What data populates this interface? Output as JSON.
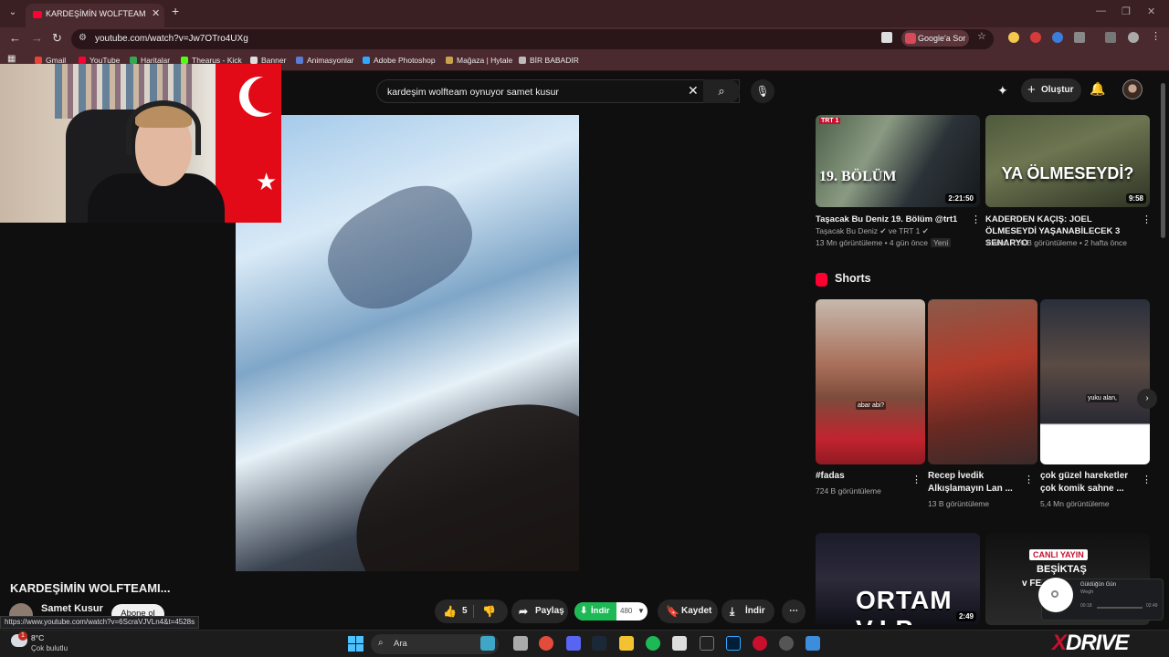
{
  "browser": {
    "tab_title": "KARDEŞİMİN WOLFTEAMI... - Yo",
    "url": "youtube.com/watch?v=Jw7OTro4UXg",
    "google_ask_label": "Google'a Sor",
    "bookmarks": [
      "Gmail",
      "YouTube",
      "Haritalar",
      "Thearus - Kick",
      "Banner",
      "Animasyonlar",
      "Adobe Photoshop",
      "Mağaza | Hytale",
      "BİR BABADIR"
    ]
  },
  "youtube": {
    "search_query": "kardeşim wolfteam oynuyor samet kusur",
    "create_label": "Oluştur",
    "video_title": "KARDEŞİMİN WOLFTEAMI...",
    "channel_name": "Samet Kusur",
    "subscribe_label": "Abone ol",
    "like_count": "5",
    "share_label": "Paylaş",
    "download_ext_label": "İndir",
    "download_ext_quality": "480",
    "save_label": "Kaydet",
    "download_label": "İndir",
    "status_link": "https://www.youtube.com/watch?v=6ScraVJVLn4&t=4528s"
  },
  "recommendations": [
    {
      "title": "Taşacak Bu Deniz 19. Bölüm @trt1",
      "channel": "Taşacak Bu Deniz ✔ ve TRT 1 ✔",
      "stats": "13 Mn görüntüleme • 4 gün önce",
      "badge": "Yeni",
      "duration": "2:21:50",
      "thumb_text": "19. BÖLÜM",
      "thumb_logo": "TRT 1"
    },
    {
      "title": "KADERDEN KAÇIŞ: JOEL ÖLMESEYDİ YAŞANABİLECEK 3 SENARYO",
      "stats": "Yokfire • 16 B görüntüleme • 2 hafta önce",
      "duration": "9:58",
      "thumb_text": "YA ÖLMESEYDİ?"
    }
  ],
  "shorts": {
    "heading": "Shorts",
    "items": [
      {
        "title": "#fadas",
        "views": "724 B görüntüleme",
        "caption": "abar abi?"
      },
      {
        "title": "Recep İvedik Alkışlamayın Lan ...",
        "views": "13 B görüntüleme",
        "caption": ""
      },
      {
        "title": "çok güzel hareketler çok komik sahne ...",
        "views": "5,4 Mn görüntüleme",
        "caption": "yuku alan,"
      }
    ]
  },
  "more_recs": {
    "rec3_thumb_text": "ORTAM V.I.P",
    "rec3_duration": "2:49",
    "rec4_live": "CANLI YAYIN",
    "rec4_team": "BEŞİKTAŞ",
    "rec4_line": "v FEN"
  },
  "miniplayer": {
    "song": "Güldüğün Gün",
    "artist": "Wegh",
    "start": "00:18",
    "end": "02:49"
  },
  "taskbar": {
    "temperature": "8°C",
    "weather": "Çok bulutlu",
    "search_label": "Ara",
    "logo_x": "X",
    "logo_rest": "DRIVE"
  }
}
